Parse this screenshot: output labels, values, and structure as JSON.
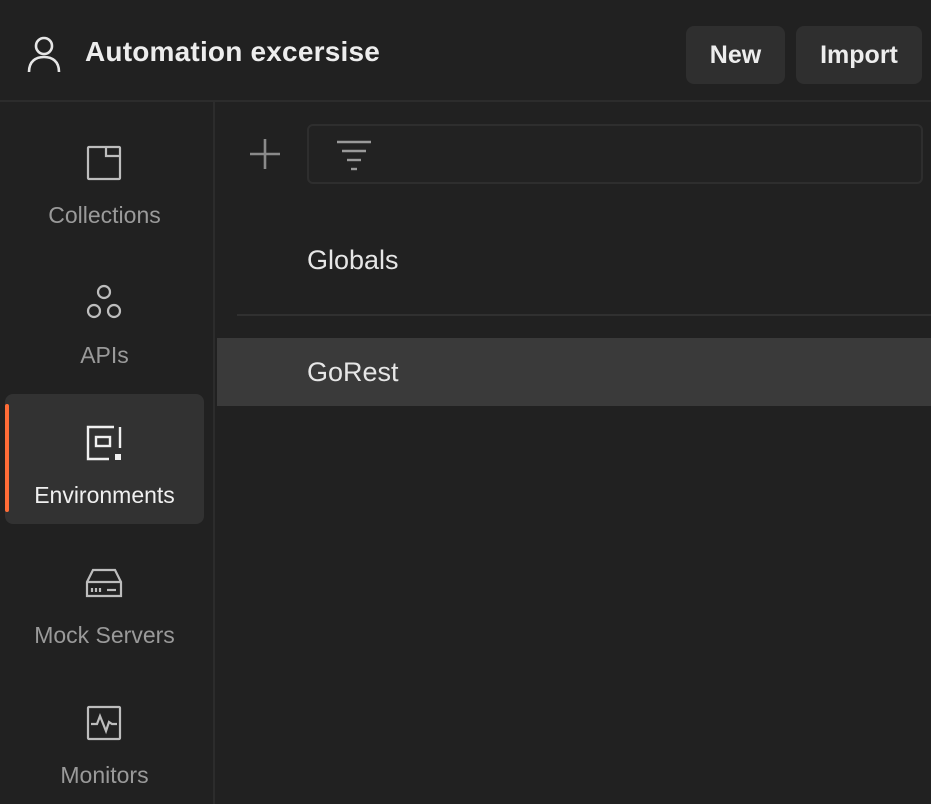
{
  "header": {
    "workspace_title": "Automation excersise",
    "new_label": "New",
    "import_label": "Import"
  },
  "sidebar": {
    "items": [
      {
        "label": "Collections",
        "icon": "collections-icon",
        "active": false
      },
      {
        "label": "APIs",
        "icon": "apis-icon",
        "active": false
      },
      {
        "label": "Environments",
        "icon": "environments-icon",
        "active": true
      },
      {
        "label": "Mock Servers",
        "icon": "mock-servers-icon",
        "active": false
      },
      {
        "label": "Monitors",
        "icon": "monitors-icon",
        "active": false
      }
    ]
  },
  "main": {
    "filter": {
      "value": "",
      "placeholder": ""
    },
    "environments": [
      {
        "name": "Globals",
        "selected": false
      },
      {
        "name": "GoRest",
        "selected": true
      }
    ]
  },
  "colors": {
    "background": "#212121",
    "active_accent": "#ff6c37",
    "selected_row": "#3a3a3a"
  }
}
